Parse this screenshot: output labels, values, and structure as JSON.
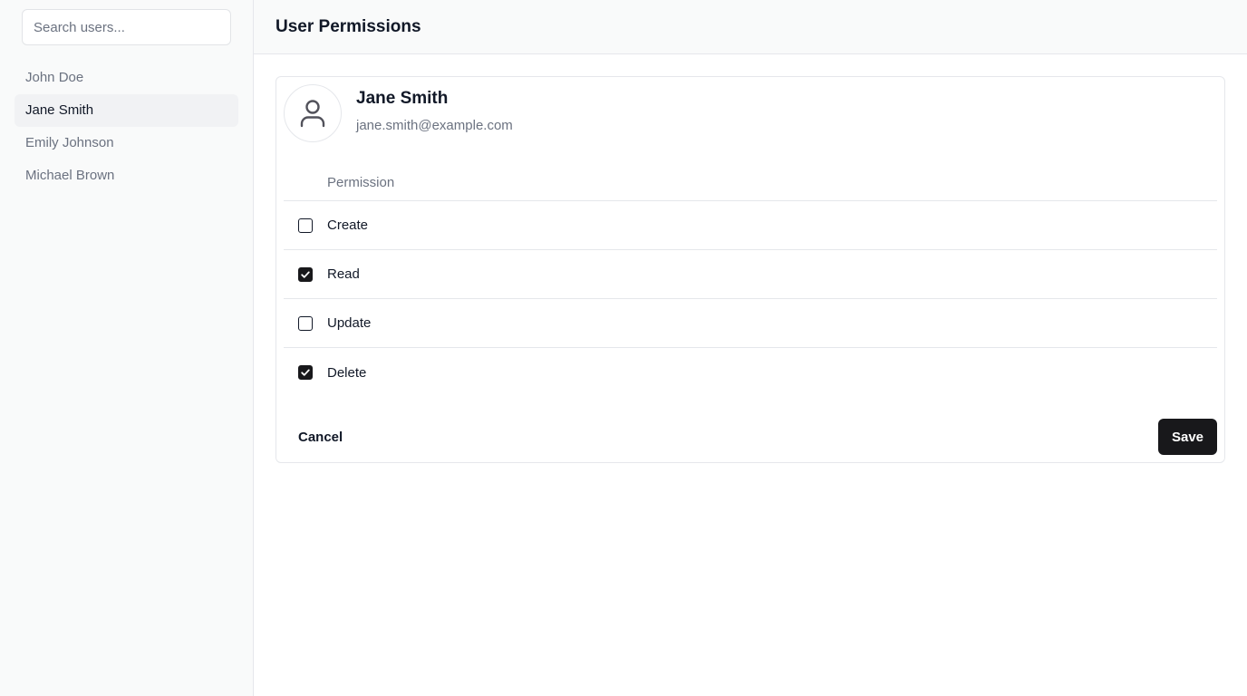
{
  "sidebar": {
    "search": {
      "placeholder": "Search users..."
    },
    "users": [
      {
        "name": "John Doe",
        "active": false
      },
      {
        "name": "Jane Smith",
        "active": true
      },
      {
        "name": "Emily Johnson",
        "active": false
      },
      {
        "name": "Michael Brown",
        "active": false
      }
    ]
  },
  "header": {
    "title": "User Permissions"
  },
  "profile": {
    "name": "Jane Smith",
    "email": "jane.smith@example.com",
    "avatar_icon": "user-icon"
  },
  "permissions": {
    "column_header": "Permission",
    "rows": [
      {
        "label": "Create",
        "checked": false
      },
      {
        "label": "Read",
        "checked": true
      },
      {
        "label": "Update",
        "checked": false
      },
      {
        "label": "Delete",
        "checked": true
      }
    ]
  },
  "actions": {
    "cancel_label": "Cancel",
    "save_label": "Save"
  },
  "colors": {
    "primary": "#18181b",
    "muted_text": "#6b7280",
    "border": "#e5e7eb",
    "sidebar_bg": "#f9fafa"
  }
}
